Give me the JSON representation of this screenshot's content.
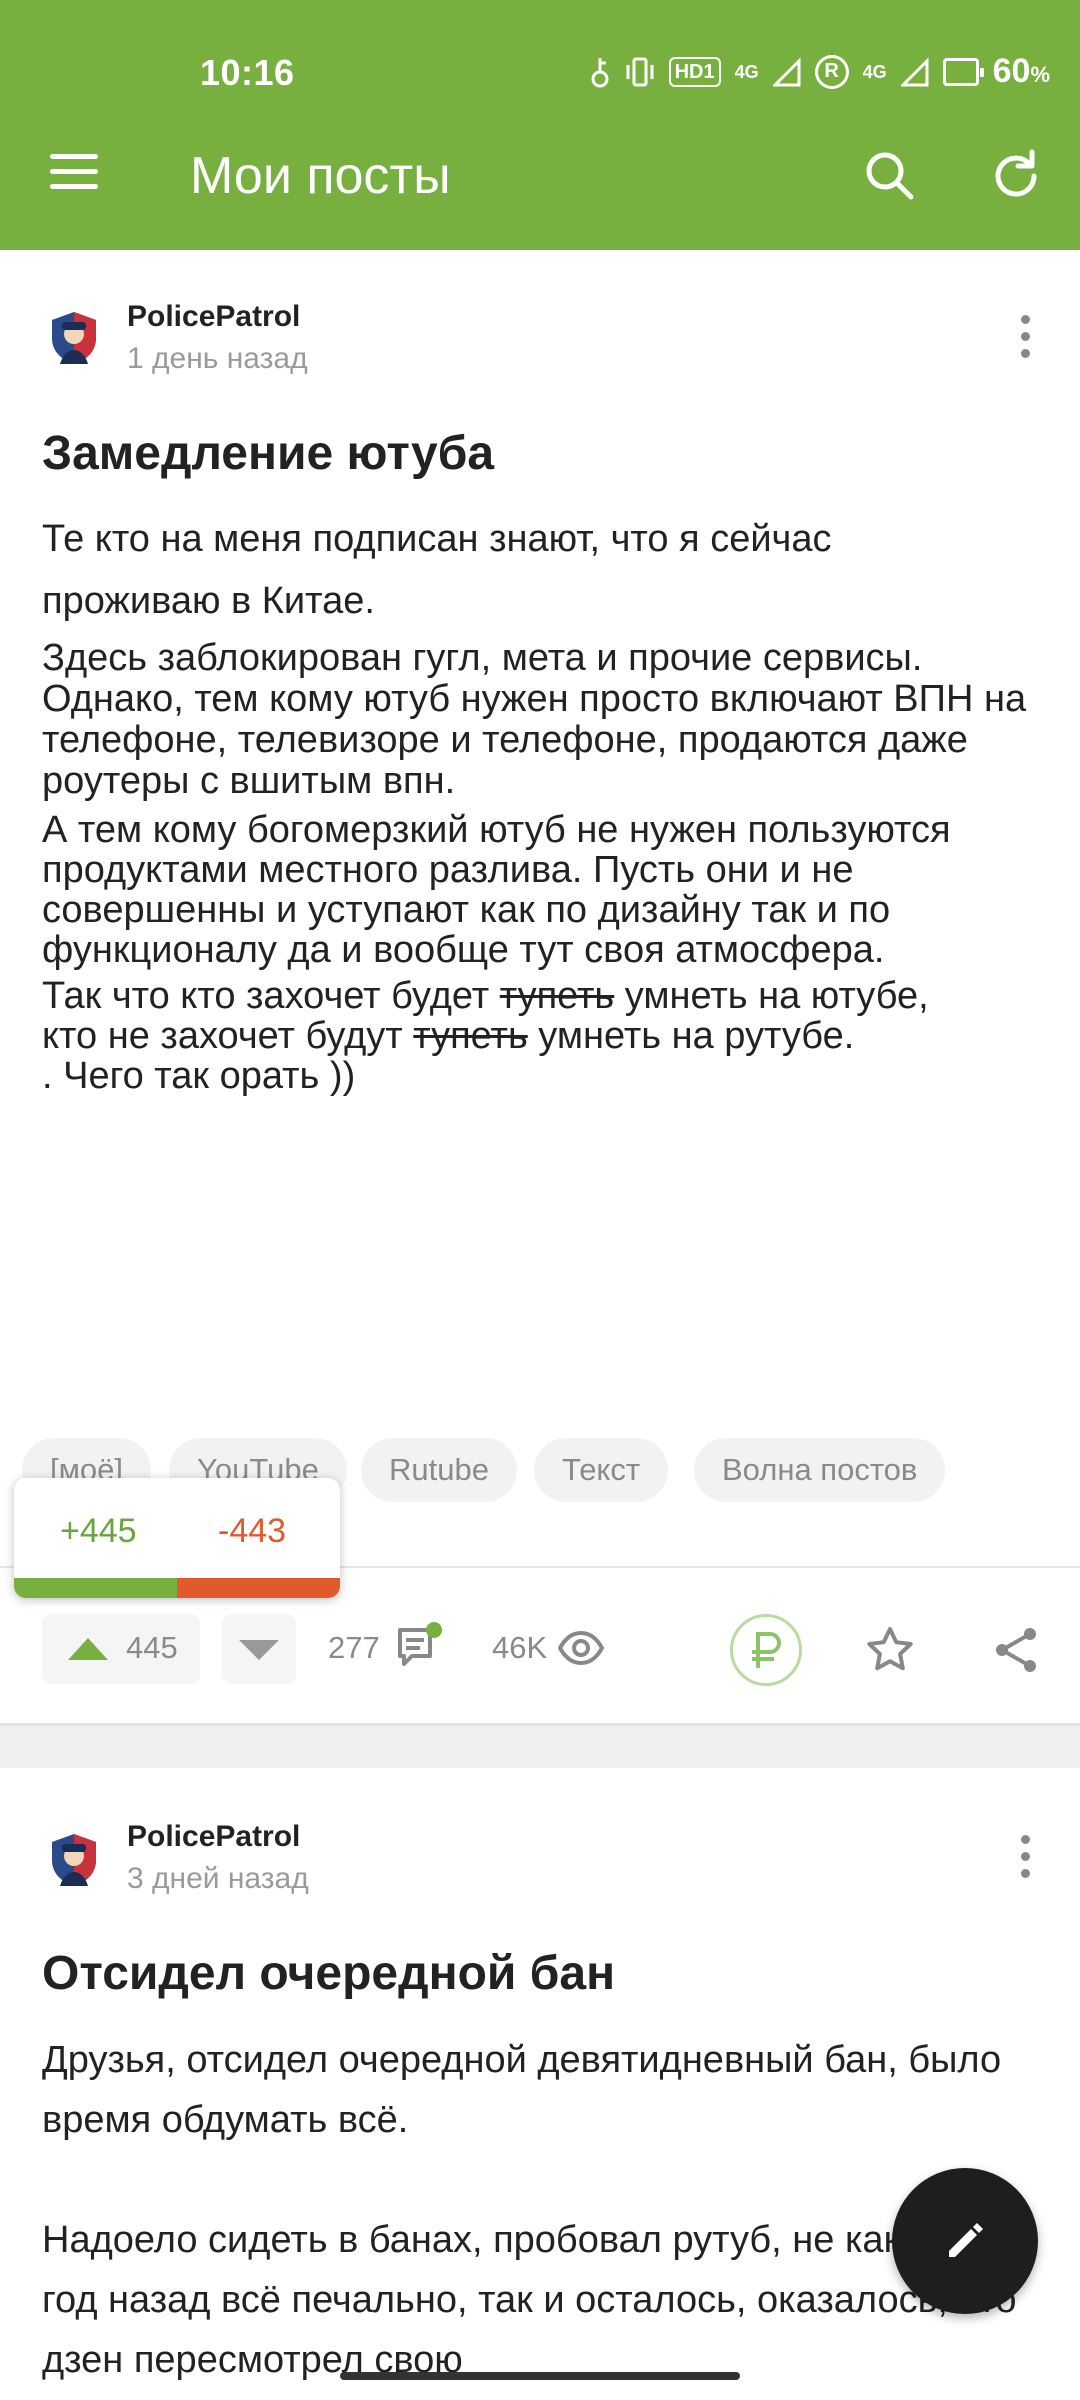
{
  "status_bar": {
    "time": "10:16",
    "network_badge": "HD1",
    "signal_1": "4G",
    "signal_2": "4G",
    "roaming": "R",
    "battery": "60",
    "battery_unit": "%"
  },
  "app_bar": {
    "title": "Мои посты",
    "menu_icon": "hamburger-menu-icon",
    "search_icon": "search-icon",
    "refresh_icon": "refresh-icon",
    "color": "#78b040"
  },
  "posts": [
    {
      "author": "PolicePatrol",
      "time_ago": "1 день назад",
      "title": "Замедление ютуба",
      "paragraphs": [
        "Те кто на меня подписан знают, что я сейчас проживаю в Китае.",
        "Здесь заблокирован гугл, мета и прочие сервисы. Однако, тем кому ютуб нужен просто включают ВПН на телефоне, телевизоре и телефоне, продаются даже роутеры с вшитым впн.",
        "А тем кому богомерзкий ютуб не нужен пользуются продуктами местного разлива. Пусть они и не совершенны и уступают как по дизайну так и по функционалу да и вообще тут своя атмосфера."
      ],
      "line_a": {
        "before": "Так что кто захочет будет ",
        "struck": "тупеть",
        "after": " умнеть на ютубе,"
      },
      "line_b": {
        "before": "кто не захочет будут ",
        "struck": "тупеть",
        "after": " умнеть на рутубе."
      },
      "line_c": ". Чего так орать ))",
      "tags": [
        "[моё]",
        "YouTube",
        "Rutube",
        "Текст",
        "Волна постов"
      ],
      "rating_plus": "+445",
      "rating_minus": "-443",
      "upvotes": "445",
      "comments": "277",
      "views": "46K",
      "icons": [
        "upvote-icon",
        "downvote-icon",
        "comment-icon",
        "eye-icon",
        "ruble-donate-icon",
        "star-icon",
        "share-icon"
      ]
    },
    {
      "author": "PolicePatrol",
      "time_ago": "3 дней назад",
      "title": "Отсидел очередной бан",
      "paragraphs": [
        "Друзья, отсидел очередной девятидневный бан, было время обдумать всё.",
        "Надоело сидеть в банах, пробовал рутуб, не как и было год назад всё печально, так и осталось, оказалось, что дзен пересмотрел свою"
      ]
    }
  ],
  "fab": {
    "icon": "pencil-icon"
  },
  "colors": {
    "green": "#78b040",
    "red": "#e05a2e",
    "muted": "#9a9a9a"
  }
}
